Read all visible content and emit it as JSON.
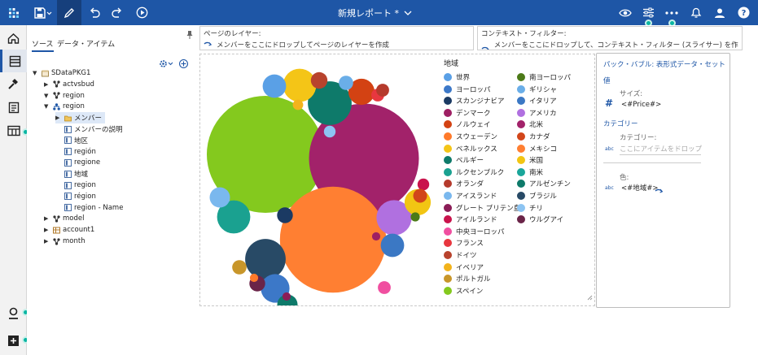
{
  "app": {
    "title": "新規レポート *",
    "accent": "#1e56a6",
    "teal": "#0bb6a3"
  },
  "toolbar": {
    "left_icons": [
      "app-logo-icon",
      "save-icon",
      "pencil-icon",
      "undo-icon",
      "redo-icon",
      "play-icon"
    ],
    "right_icons": [
      "eye-icon",
      "sliders-icon",
      "more-icon",
      "bell-icon",
      "user-icon",
      "help-icon"
    ]
  },
  "rail": {
    "icons": [
      "home-icon",
      "pages-icon",
      "hammer-icon",
      "document-icon",
      "table-icon",
      "badge-icon",
      "plus-icon"
    ]
  },
  "source": {
    "tabs": [
      "ソース",
      "データ・アイテム"
    ],
    "tree": [
      {
        "label": "SDataPKG1",
        "level": 0,
        "expander": "▼",
        "icon": "package"
      },
      {
        "label": "actvsbud",
        "level": 1,
        "expander": "▶",
        "icon": "dim"
      },
      {
        "label": "region",
        "level": 1,
        "expander": "▼",
        "icon": "dim"
      },
      {
        "label": "region",
        "level": 2,
        "expander": "▼",
        "icon": "hier"
      },
      {
        "label": "メンバー",
        "level": 3,
        "expander": "▶",
        "icon": "folder"
      },
      {
        "label": "メンバーの説明",
        "level": 3,
        "expander": "",
        "icon": "attr"
      },
      {
        "label": "地区",
        "level": 3,
        "expander": "",
        "icon": "attr"
      },
      {
        "label": "región",
        "level": 3,
        "expander": "",
        "icon": "attr"
      },
      {
        "label": "regione",
        "level": 3,
        "expander": "",
        "icon": "attr"
      },
      {
        "label": "地域",
        "level": 3,
        "expander": "",
        "icon": "attr"
      },
      {
        "label": "region",
        "level": 3,
        "expander": "",
        "icon": "attr"
      },
      {
        "label": "région",
        "level": 3,
        "expander": "",
        "icon": "attr"
      },
      {
        "label": "region - Name",
        "level": 3,
        "expander": "",
        "icon": "attr"
      },
      {
        "label": "model",
        "level": 1,
        "expander": "▶",
        "icon": "dim"
      },
      {
        "label": "account1",
        "level": 1,
        "expander": "▶",
        "icon": "cube"
      },
      {
        "label": "month",
        "level": 1,
        "expander": "▶",
        "icon": "dim"
      }
    ]
  },
  "page_layer": {
    "title": "ページのレイヤー:",
    "hint": "メンバーをここにドロップしてページのレイヤーを作成"
  },
  "context_filter": {
    "title": "コンテキスト・フィルター:",
    "hint": "メンバーをここにドロップして、コンテキスト・フィルター (スライサー) を作成"
  },
  "chart_data": {
    "type": "bubble",
    "legend_title": "地域",
    "legend_placement": "right",
    "categories": [
      {
        "name": "世界",
        "color": "#5aa0e6"
      },
      {
        "name": "ヨーロッパ",
        "color": "#3c78c8"
      },
      {
        "name": "スカンジナビア",
        "color": "#1b3a63"
      },
      {
        "name": "デンマーク",
        "color": "#9e1f63"
      },
      {
        "name": "ノルウェイ",
        "color": "#d34213"
      },
      {
        "name": "スウェーデン",
        "color": "#ff7a2a"
      },
      {
        "name": "ベネルックス",
        "color": "#f4c517"
      },
      {
        "name": "ベルギー",
        "color": "#0e7a6a"
      },
      {
        "name": "ルクセンブルク",
        "color": "#1aa190"
      },
      {
        "name": "オランダ",
        "color": "#b53a2c"
      },
      {
        "name": "アイスランド",
        "color": "#7ab8ee"
      },
      {
        "name": "グレート ブリテン島",
        "color": "#8b1d57"
      },
      {
        "name": "アイルランド",
        "color": "#c9134c"
      },
      {
        "name": "中央ヨーロッパ",
        "color": "#f04fa0"
      },
      {
        "name": "フランス",
        "color": "#e8373f"
      },
      {
        "name": "ドイツ",
        "color": "#b8432d"
      },
      {
        "name": "イベリア",
        "color": "#f2b31c"
      },
      {
        "name": "ポルトガル",
        "color": "#c8962a"
      },
      {
        "name": "スペイン",
        "color": "#84c91e"
      },
      {
        "name": "南ヨーロッパ",
        "color": "#4c7a18"
      },
      {
        "name": "ギリシャ",
        "color": "#6aaee8"
      },
      {
        "name": "イタリア",
        "color": "#3b78c4"
      },
      {
        "name": "アメリカ",
        "color": "#b070e0"
      },
      {
        "name": "北米",
        "color": "#a2226a"
      },
      {
        "name": "カナダ",
        "color": "#d2461a"
      },
      {
        "name": "メキシコ",
        "color": "#ff7f32"
      },
      {
        "name": "米国",
        "color": "#f2c513"
      },
      {
        "name": "南米",
        "color": "#1aa69a"
      },
      {
        "name": "アルゼンチン",
        "color": "#0e7a6a"
      },
      {
        "name": "ブラジル",
        "color": "#284a66"
      },
      {
        "name": "チリ",
        "color": "#8dc4f2"
      },
      {
        "name": "ウルグアイ",
        "color": "#6a2448"
      }
    ],
    "bubbles": [
      {
        "category": "スペイン",
        "value": 100
      },
      {
        "category": "北米",
        "value": 88
      },
      {
        "category": "メキシコ",
        "value": 82
      },
      {
        "category": "ベルギー",
        "value": 14
      },
      {
        "category": "ベネルックス",
        "value": 8
      },
      {
        "category": "ノルウェイ",
        "value": 5
      },
      {
        "category": "ブラジル",
        "value": 12
      },
      {
        "category": "ルクセンブルク",
        "value": 8
      },
      {
        "category": "アメリカ",
        "value": 9
      },
      {
        "category": "世界",
        "value": 4
      },
      {
        "category": "ヨーロッパ",
        "value": 6
      },
      {
        "category": "米国",
        "value": 5
      },
      {
        "category": "イタリア",
        "value": 4
      },
      {
        "category": "スカンジナビア",
        "value": 1.8
      },
      {
        "category": "アイスランド",
        "value": 3
      },
      {
        "category": "ウルグアイ",
        "value": 1.8
      },
      {
        "category": "アルゼンチン",
        "value": 3
      },
      {
        "category": "ギリシャ",
        "value": 1.5
      },
      {
        "category": "ドイツ",
        "value": 2
      },
      {
        "category": "フランス",
        "value": 1.2
      },
      {
        "category": "中央ヨーロッパ",
        "value": 1.2
      },
      {
        "category": "ポルトガル",
        "value": 1.5
      },
      {
        "category": "オランダ",
        "value": 1.2
      },
      {
        "category": "チリ",
        "value": 1
      },
      {
        "category": "アイルランド",
        "value": 1
      },
      {
        "category": "南ヨーロッパ",
        "value": 0.6
      },
      {
        "category": "カナダ",
        "value": 1.4
      },
      {
        "category": "グレート ブリテン島",
        "value": 0.5
      },
      {
        "category": "イベリア",
        "value": 0.8
      },
      {
        "category": "デンマーク",
        "value": 0.5
      },
      {
        "category": "スウェーデン",
        "value": 0.5
      }
    ]
  },
  "properties": {
    "title": "パック・バブル: 表形式データ・セット",
    "value_section": "値",
    "size_label": "サイズ:",
    "size_value": "<#Price#>",
    "category_section": "カテゴリー",
    "category_label": "カテゴリー:",
    "category_placeholder": "ここにアイテムをドロップ",
    "color_label": "色:",
    "color_value": "<#地域#>"
  }
}
